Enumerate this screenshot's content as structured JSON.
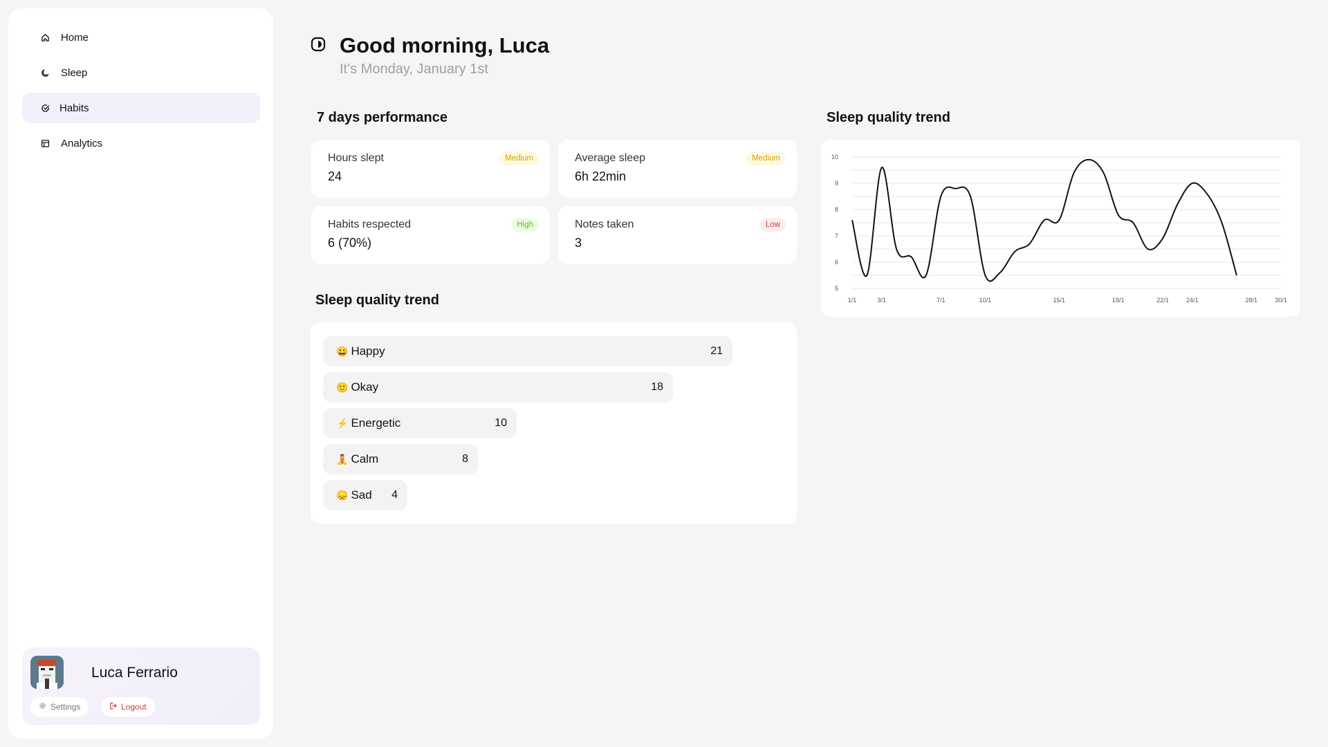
{
  "sidebar": {
    "items": [
      {
        "label": "Home",
        "icon": "home-icon",
        "active": false
      },
      {
        "label": "Sleep",
        "icon": "moon-icon",
        "active": false
      },
      {
        "label": "Habits",
        "icon": "check-circle-icon",
        "active": true
      },
      {
        "label": "Analytics",
        "icon": "table-icon",
        "active": false
      }
    ]
  },
  "profile": {
    "name": "Luca Ferrario",
    "avatar": "pixel-avatar-icon",
    "settings_label": "Settings",
    "logout_label": "Logout"
  },
  "header": {
    "greeting": "Good morning, Luca",
    "date": "It’s Monday, January 1st"
  },
  "performance": {
    "title": "7 days performance",
    "stats": [
      {
        "label": "Hours slept",
        "value": "24",
        "badge": "Medium",
        "level": "medium"
      },
      {
        "label": "Average sleep",
        "value": "6h 22min",
        "badge": "Medium",
        "level": "medium"
      },
      {
        "label": "Habits respected",
        "value": "6 (70%)",
        "badge": "High",
        "level": "high"
      },
      {
        "label": "Notes taken",
        "value": "3",
        "badge": "Low",
        "level": "low"
      }
    ]
  },
  "moods": {
    "title": "Sleep quality trend",
    "items": [
      {
        "emoji": "😀",
        "label": "Happy",
        "count": "21"
      },
      {
        "emoji": "🙂",
        "label": "Okay",
        "count": "18"
      },
      {
        "emoji": "⚡",
        "label": "Energetic",
        "count": "10"
      },
      {
        "emoji": "🧘",
        "label": "Calm",
        "count": "8"
      },
      {
        "emoji": "😞",
        "label": "Sad",
        "count": "4"
      }
    ]
  },
  "trend": {
    "title": "Sleep quality trend"
  },
  "colors": {
    "accent_bg": "#f3effb",
    "badge_medium": "#d1a810",
    "badge_high": "#5cbf23",
    "badge_low": "#d33a3a"
  },
  "chart_data": {
    "type": "line",
    "title": "",
    "xlabel": "",
    "ylabel": "",
    "ylim": [
      5,
      10
    ],
    "yticks": [
      "5",
      "6",
      "7",
      "8",
      "9",
      "10"
    ],
    "xticks": [
      "1/1",
      "3/1",
      "7/1",
      "10/1",
      "15/1",
      "19/1",
      "22/1",
      "24/1",
      "28/1",
      "30/1"
    ],
    "grid": true,
    "series": [
      {
        "x": [
          1,
          2,
          3,
          4,
          5,
          6,
          7,
          8,
          9,
          10,
          11,
          12,
          13,
          14,
          15,
          16,
          17,
          18,
          19,
          20,
          21,
          22,
          23,
          24,
          25,
          26,
          27,
          28,
          29,
          30
        ],
        "values": [
          7.6,
          5.5,
          9.6,
          6.5,
          6.2,
          5.5,
          8.5,
          8.8,
          8.5,
          5.5,
          5.6,
          6.4,
          6.7,
          7.6,
          7.6,
          9.4,
          9.9,
          9.4,
          7.8,
          7.5,
          6.5,
          6.9,
          8.2,
          9.0,
          8.6,
          7.5,
          5.5,
          null,
          null,
          null
        ]
      }
    ]
  }
}
